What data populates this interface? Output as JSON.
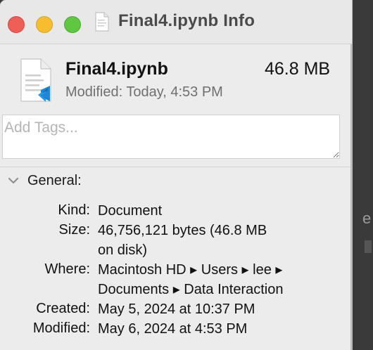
{
  "window": {
    "title": "Final4.ipynb Info"
  },
  "file": {
    "name": "Final4.ipynb",
    "size": "46.8 MB",
    "modified": "Modified: Today, 4:53 PM",
    "icon": "ipynb-document-icon",
    "badge_icon": "vscode-badge-icon"
  },
  "tags": {
    "placeholder": "Add Tags..."
  },
  "general": {
    "label": "General:",
    "expanded": true,
    "rows": [
      {
        "key": "Kind:",
        "lines": [
          "Document"
        ]
      },
      {
        "key": "Size:",
        "lines": [
          "46,756,121 bytes (46.8 MB",
          "on disk)"
        ]
      },
      {
        "key": "Where:",
        "lines": [
          "Macintosh HD ▸ Users ▸ lee ▸",
          "Documents ▸ Data Interaction"
        ]
      },
      {
        "key": "Created:",
        "lines": [
          "May 5, 2024 at 10:37 PM"
        ]
      },
      {
        "key": "Modified:",
        "lines": [
          "May 6, 2024 at 4:53 PM"
        ]
      }
    ]
  },
  "background": {
    "peek_text": "e"
  },
  "colors": {
    "close": "#ee5f57",
    "minimize": "#f5bd2f",
    "zoom": "#5fc840",
    "vscode_blue": "#1f87d8"
  }
}
